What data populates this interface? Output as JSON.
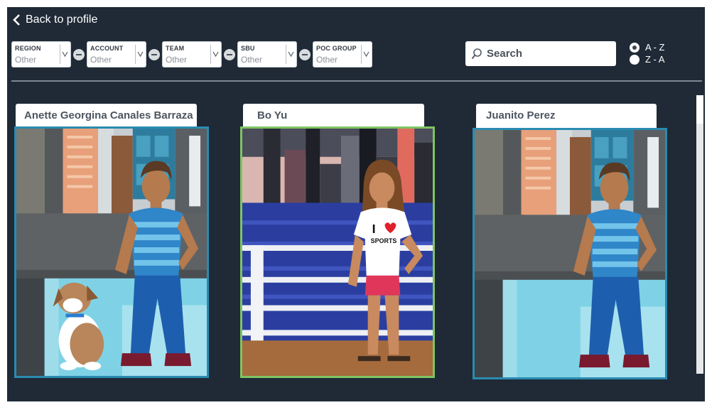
{
  "nav": {
    "back_label": "Back to profile"
  },
  "filters": [
    {
      "label": "REGION",
      "value": "Other"
    },
    {
      "label": "ACCOUNT",
      "value": "Other"
    },
    {
      "label": "TEAM",
      "value": "Other"
    },
    {
      "label": "SBU",
      "value": "Other"
    },
    {
      "label": "POC GROUP",
      "value": "Other"
    }
  ],
  "search": {
    "placeholder": "Search",
    "value": ""
  },
  "sort": {
    "options": [
      "A - Z",
      "Z - A"
    ],
    "selected": "A - Z"
  },
  "cards": [
    {
      "name": "Anette Georgina Canales Barraza",
      "scene": "city-street",
      "avatar": "man-striped-shirt",
      "pet": "dog",
      "border_color": "#2a8bb0"
    },
    {
      "name": "Bo Yu",
      "scene": "waterfront-railing",
      "avatar": "woman-i-love-sports-tshirt",
      "shirt_text": "I ♥ SPORTS",
      "border_color": "#7ec463"
    },
    {
      "name": "Juanito Perez",
      "scene": "city-street",
      "avatar": "man-striped-shirt",
      "border_color": "#2a8bb0"
    }
  ]
}
